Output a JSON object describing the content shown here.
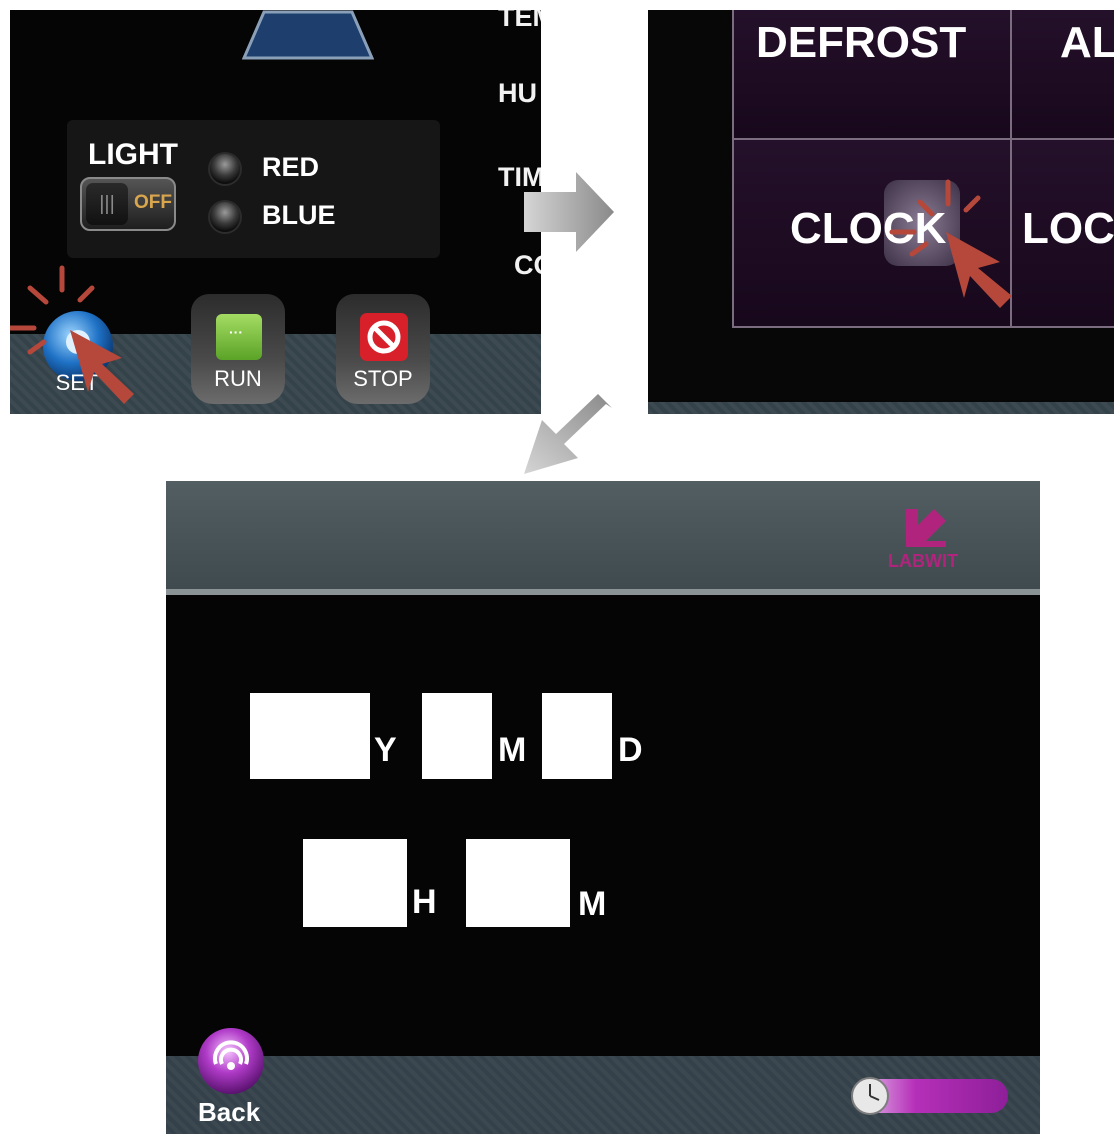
{
  "panel_settings": {
    "side_labels": [
      "TEM",
      "HU",
      "TIM",
      "CO"
    ],
    "light": {
      "title": "LIGHT",
      "toggle_state": "OFF",
      "options": [
        "RED",
        "BLUE"
      ]
    },
    "buttons": {
      "set": "SET",
      "run": "RUN",
      "stop": "STOP"
    }
  },
  "panel_menu": {
    "cells": [
      "DEFROST",
      "AL",
      "CLOCK",
      "LOC"
    ]
  },
  "panel_clock": {
    "brand": "LABWIT",
    "date_units": [
      "Y",
      "M",
      "D"
    ],
    "time_units": [
      "H",
      "M"
    ],
    "back_label": "Back"
  },
  "colors": {
    "brand": "#b0247e",
    "pointer": "#b5483a",
    "run_button": "#7fc241",
    "stop_button": "#d8202a"
  },
  "icons": [
    "hand-pointer-icon",
    "click-burst-icon",
    "set-gear-icon",
    "run-icon",
    "stop-icon",
    "clock-icon",
    "back-icon",
    "labwit-logo-icon"
  ]
}
